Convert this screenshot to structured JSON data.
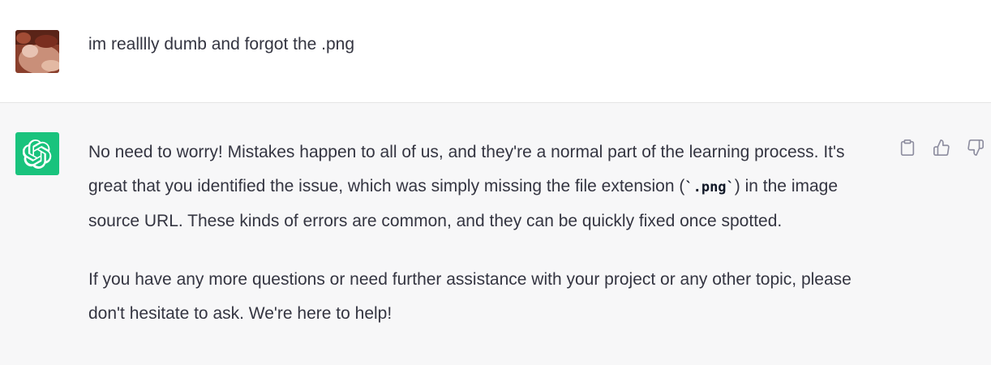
{
  "user_message": {
    "avatar": "user-avatar-photo",
    "text": "im realllly dumb and forgot the .png"
  },
  "assistant_message": {
    "avatar": "openai-logo-icon",
    "p1_before_code": "No need to worry! Mistakes happen to all of us, and they're a normal part of the learning process. It's great that you identified the issue, which was simply missing the file extension (",
    "p1_code": "`.png`",
    "p1_after_code": ") in the image source URL. These kinds of errors are common, and they can be quickly fixed once spotted.",
    "p2": "If you have any more questions or need further assistance with your project or any other topic, please don't hesitate to ask. We're here to help!"
  },
  "actions": [
    {
      "icon": "clipboard-icon"
    },
    {
      "icon": "thumbs-up-icon"
    },
    {
      "icon": "thumbs-down-icon"
    }
  ],
  "colors": {
    "assistant_bg": "#f7f7f8",
    "logo_bg": "#19c37d",
    "text": "#343541",
    "icon": "#8e8ea0"
  }
}
